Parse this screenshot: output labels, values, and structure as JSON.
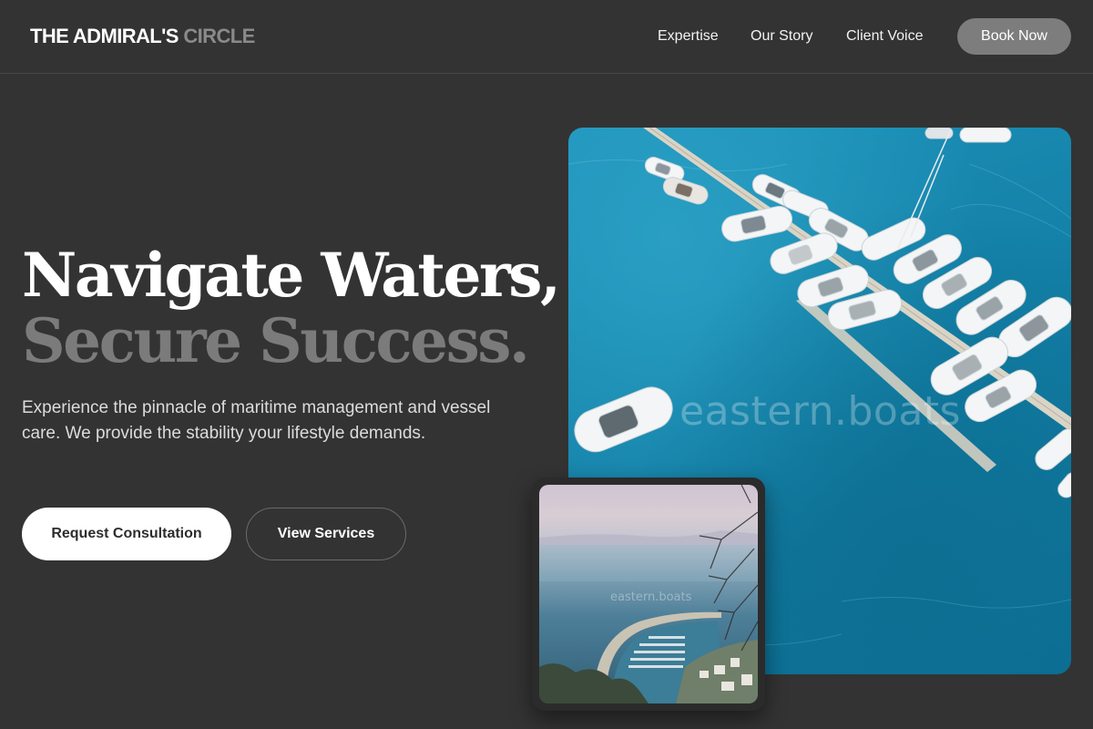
{
  "brand": {
    "primary": "THE ADMIRAL'S",
    "secondary": "CIRCLE"
  },
  "nav": {
    "links": [
      "Expertise",
      "Our Story",
      "Client Voice"
    ],
    "cta": "Book Now"
  },
  "hero": {
    "headline_line1": "Navigate Waters,",
    "headline_line2": "Secure Success.",
    "description": "Experience the pinnacle of maritime management and vessel care. We provide the stability your lifestyle demands.",
    "primary_cta": "Request Consultation",
    "secondary_cta": "View Services"
  },
  "images": {
    "main_watermark": "eastern.boats",
    "sub_watermark": "eastern.boats"
  },
  "colors": {
    "background": "#333333",
    "muted_text": "#7b7b7b",
    "book_button": "#7d7d7d",
    "water": "#1a8ab2"
  }
}
